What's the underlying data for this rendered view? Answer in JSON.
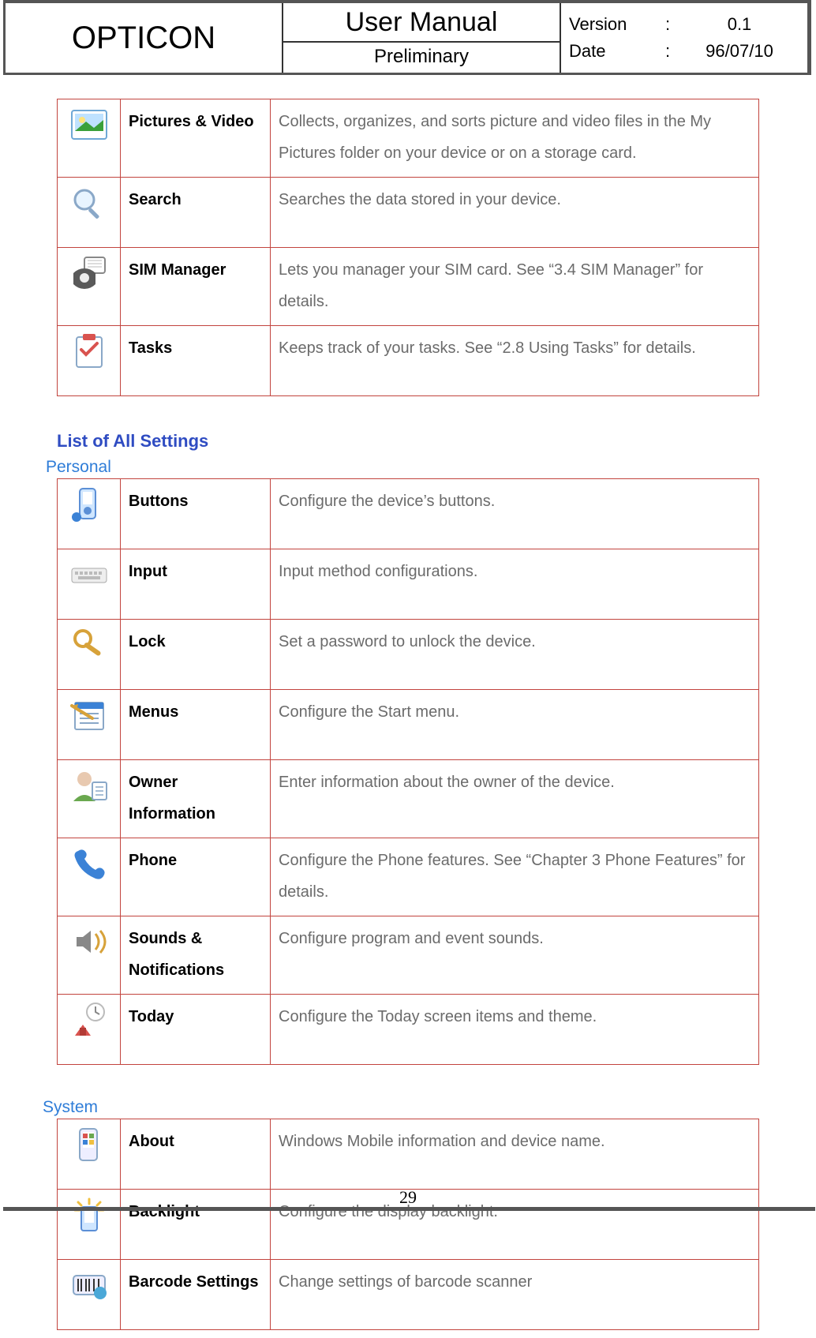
{
  "header": {
    "company": "OPTICON",
    "manual_title": "User Manual",
    "manual_subtitle": "Preliminary",
    "version_label": "Version",
    "version_value": "0.1",
    "date_label": "Date",
    "date_value": "96/07/10"
  },
  "programs": [
    {
      "name": "Pictures & Video",
      "desc": "Collects, organizes, and sorts picture and video files in the My Pictures folder on your device or on a storage card.",
      "icon": "pictures-icon"
    },
    {
      "name": "Search",
      "desc": "Searches the data stored in your device.",
      "icon": "search-icon"
    },
    {
      "name": "SIM Manager",
      "desc": "Lets you manager your SIM card. See “3.4 SIM Manager” for details.",
      "icon": "sim-manager-icon"
    },
    {
      "name": "Tasks",
      "desc": "Keeps track of your tasks. See “2.8 Using Tasks” for details.",
      "icon": "tasks-icon"
    }
  ],
  "settings_title": "List of All Settings",
  "settings_personal_title": "Personal",
  "settings_personal": [
    {
      "name": "Buttons",
      "desc": "Configure the device’s buttons.",
      "icon": "buttons-icon"
    },
    {
      "name": "Input",
      "desc": "Input method configurations.",
      "icon": "input-icon"
    },
    {
      "name": "Lock",
      "desc": "Set a password to unlock the device.",
      "icon": "lock-icon"
    },
    {
      "name": "Menus",
      "desc": "Configure the Start menu.",
      "icon": "menus-icon"
    },
    {
      "name": "Owner Information",
      "desc": "Enter information about the owner of the device.",
      "icon": "owner-info-icon"
    },
    {
      "name": "Phone",
      "desc": "Configure the Phone features. See “Chapter 3 Phone Features” for details.",
      "icon": "phone-icon"
    },
    {
      "name": "Sounds & Notifications",
      "desc": "Configure program and event sounds.",
      "icon": "sounds-icon"
    },
    {
      "name": "Today",
      "desc": "Configure the Today screen items and theme.",
      "icon": "today-icon"
    }
  ],
  "settings_system_title": "System",
  "settings_system": [
    {
      "name": "About",
      "desc": "Windows Mobile information and device name.",
      "icon": "about-icon"
    },
    {
      "name": "Backlight",
      "desc": "Configure the display backlight.",
      "icon": "backlight-icon"
    },
    {
      "name": "Barcode Settings",
      "desc": "Change settings of barcode scanner",
      "icon": "barcode-icon"
    }
  ],
  "page_number": "29"
}
